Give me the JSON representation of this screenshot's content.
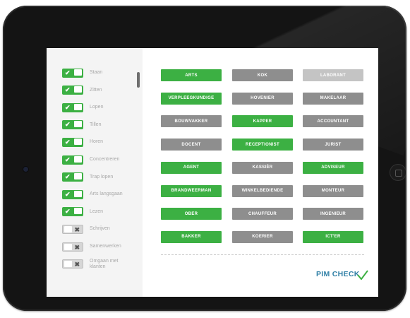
{
  "app": {
    "logo_text": "PIM CHECK",
    "colors": {
      "green": "#3cb043",
      "gray": "#8e8e8e",
      "light_gray": "#c4c4c4",
      "logo_blue": "#2f7fa6"
    }
  },
  "sidebar": {
    "items": [
      {
        "label": "Staan",
        "on": true
      },
      {
        "label": "Zitten",
        "on": true
      },
      {
        "label": "Lopen",
        "on": true
      },
      {
        "label": "Tillen",
        "on": true
      },
      {
        "label": "Horen",
        "on": true
      },
      {
        "label": "Concentreren",
        "on": true
      },
      {
        "label": "Trap lopen",
        "on": true
      },
      {
        "label": "Arts langsgaan",
        "on": true
      },
      {
        "label": "Lezen",
        "on": true
      },
      {
        "label": "Schrijven",
        "on": false
      },
      {
        "label": "Samenwerken",
        "on": false
      },
      {
        "label": "Omgaan met klanten",
        "on": false
      }
    ]
  },
  "professions": [
    {
      "label": "ARTS",
      "state": "green"
    },
    {
      "label": "KOK",
      "state": "gray"
    },
    {
      "label": "LABORANT",
      "state": "lightgray"
    },
    {
      "label": "VERPLEEGKUNDIGE",
      "state": "green"
    },
    {
      "label": "HOVENIER",
      "state": "gray"
    },
    {
      "label": "MAKELAAR",
      "state": "gray"
    },
    {
      "label": "BOUWVAKKER",
      "state": "gray"
    },
    {
      "label": "KAPPER",
      "state": "green"
    },
    {
      "label": "ACCOUNTANT",
      "state": "gray"
    },
    {
      "label": "DOCENT",
      "state": "gray"
    },
    {
      "label": "RECEPTIONIST",
      "state": "green"
    },
    {
      "label": "JURIST",
      "state": "gray"
    },
    {
      "label": "AGENT",
      "state": "green"
    },
    {
      "label": "KASSIÈR",
      "state": "gray"
    },
    {
      "label": "ADVISEUR",
      "state": "green"
    },
    {
      "label": "BRANDWEERMAN",
      "state": "green"
    },
    {
      "label": "WINKELBEDIENDE",
      "state": "gray"
    },
    {
      "label": "MONTEUR",
      "state": "gray"
    },
    {
      "label": "OBER",
      "state": "green"
    },
    {
      "label": "CHAUFFEUR",
      "state": "gray"
    },
    {
      "label": "INGENIEUR",
      "state": "gray"
    },
    {
      "label": "BAKKER",
      "state": "green"
    },
    {
      "label": "KOERIER",
      "state": "gray"
    },
    {
      "label": "ICT'ER",
      "state": "green"
    }
  ]
}
